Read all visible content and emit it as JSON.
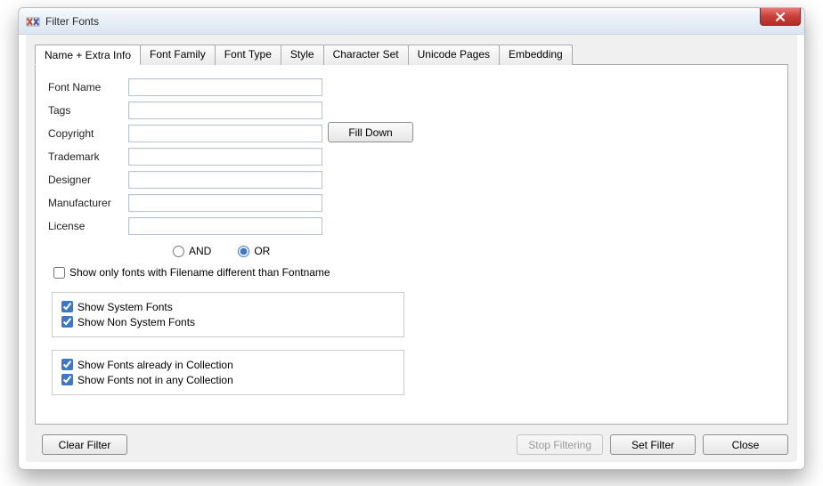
{
  "window": {
    "title": "Filter Fonts"
  },
  "tabs": [
    {
      "label": "Name + Extra Info",
      "active": true
    },
    {
      "label": "Font Family",
      "active": false
    },
    {
      "label": "Font Type",
      "active": false
    },
    {
      "label": "Style",
      "active": false
    },
    {
      "label": "Character Set",
      "active": false
    },
    {
      "label": "Unicode Pages",
      "active": false
    },
    {
      "label": "Embedding",
      "active": false
    }
  ],
  "fields": {
    "font_name": {
      "label": "Font Name",
      "value": ""
    },
    "tags": {
      "label": "Tags",
      "value": ""
    },
    "copyright": {
      "label": "Copyright",
      "value": ""
    },
    "trademark": {
      "label": "Trademark",
      "value": ""
    },
    "designer": {
      "label": "Designer",
      "value": ""
    },
    "manufacturer": {
      "label": "Manufacturer",
      "value": ""
    },
    "license": {
      "label": "License",
      "value": ""
    }
  },
  "fill_down_label": "Fill Down",
  "logic": {
    "and_label": "AND",
    "or_label": "OR",
    "selected": "OR"
  },
  "filename_diff": {
    "label": "Show only fonts with Filename different than Fontname",
    "checked": false
  },
  "system_group": {
    "show_system": {
      "label": "Show System Fonts",
      "checked": true
    },
    "show_non_system": {
      "label": "Show Non System Fonts",
      "checked": true
    }
  },
  "collection_group": {
    "in_collection": {
      "label": "Show Fonts already in Collection",
      "checked": true
    },
    "not_in_collection": {
      "label": "Show Fonts not in any Collection",
      "checked": true
    }
  },
  "buttons": {
    "clear_filter": "Clear Filter",
    "stop_filtering": "Stop Filtering",
    "set_filter": "Set Filter",
    "close": "Close"
  },
  "stop_filtering_enabled": false
}
